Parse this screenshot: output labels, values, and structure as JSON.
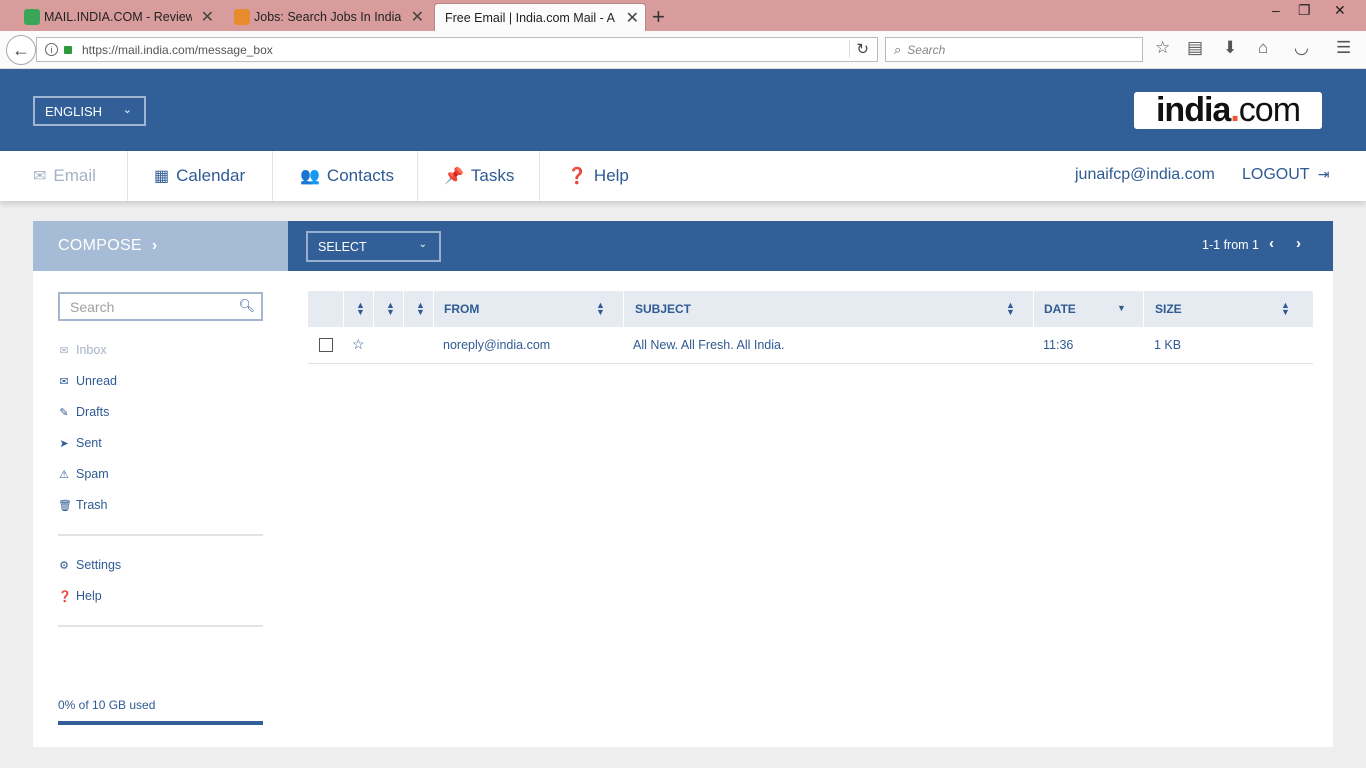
{
  "browser": {
    "tabs": [
      {
        "title": "MAIL.INDIA.COM - Reviews"
      },
      {
        "title": "Jobs: Search Jobs In India, Fr"
      },
      {
        "title": "Free Email | India.com Mail - An"
      }
    ],
    "url": "https://mail.india.com/message_box",
    "search_placeholder": "Search"
  },
  "header": {
    "language": "ENGLISH",
    "logo_main": "india",
    "logo_dot": ".",
    "logo_tld": "com"
  },
  "nav": {
    "items": [
      {
        "label": "Email"
      },
      {
        "label": "Calendar"
      },
      {
        "label": "Contacts"
      },
      {
        "label": "Tasks"
      },
      {
        "label": "Help"
      }
    ],
    "user_email": "junaifcp@india.com",
    "logout": "LOGOUT"
  },
  "sidebar": {
    "compose": "COMPOSE",
    "search_placeholder": "Search",
    "folders": [
      {
        "label": "Inbox",
        "icon": "envelope-icon"
      },
      {
        "label": "Unread",
        "icon": "envelope-icon"
      },
      {
        "label": "Drafts",
        "icon": "pencil-icon"
      },
      {
        "label": "Sent",
        "icon": "send-icon"
      },
      {
        "label": "Spam",
        "icon": "spam-icon"
      },
      {
        "label": "Trash",
        "icon": "trash-icon"
      }
    ],
    "extras": [
      {
        "label": "Settings",
        "icon": "gear-icon"
      },
      {
        "label": "Help",
        "icon": "question-icon"
      }
    ],
    "usage": "0% of 10 GB used",
    "usage_percent": 0
  },
  "toolbar": {
    "select": "SELECT",
    "pager": "1-1 from 1"
  },
  "table": {
    "columns": [
      "FROM",
      "SUBJECT",
      "DATE",
      "SIZE"
    ],
    "rows": [
      {
        "from": "noreply@india.com",
        "subject": "All New. All Fresh. All India.",
        "date": "11:36",
        "size": "1 KB"
      }
    ]
  }
}
